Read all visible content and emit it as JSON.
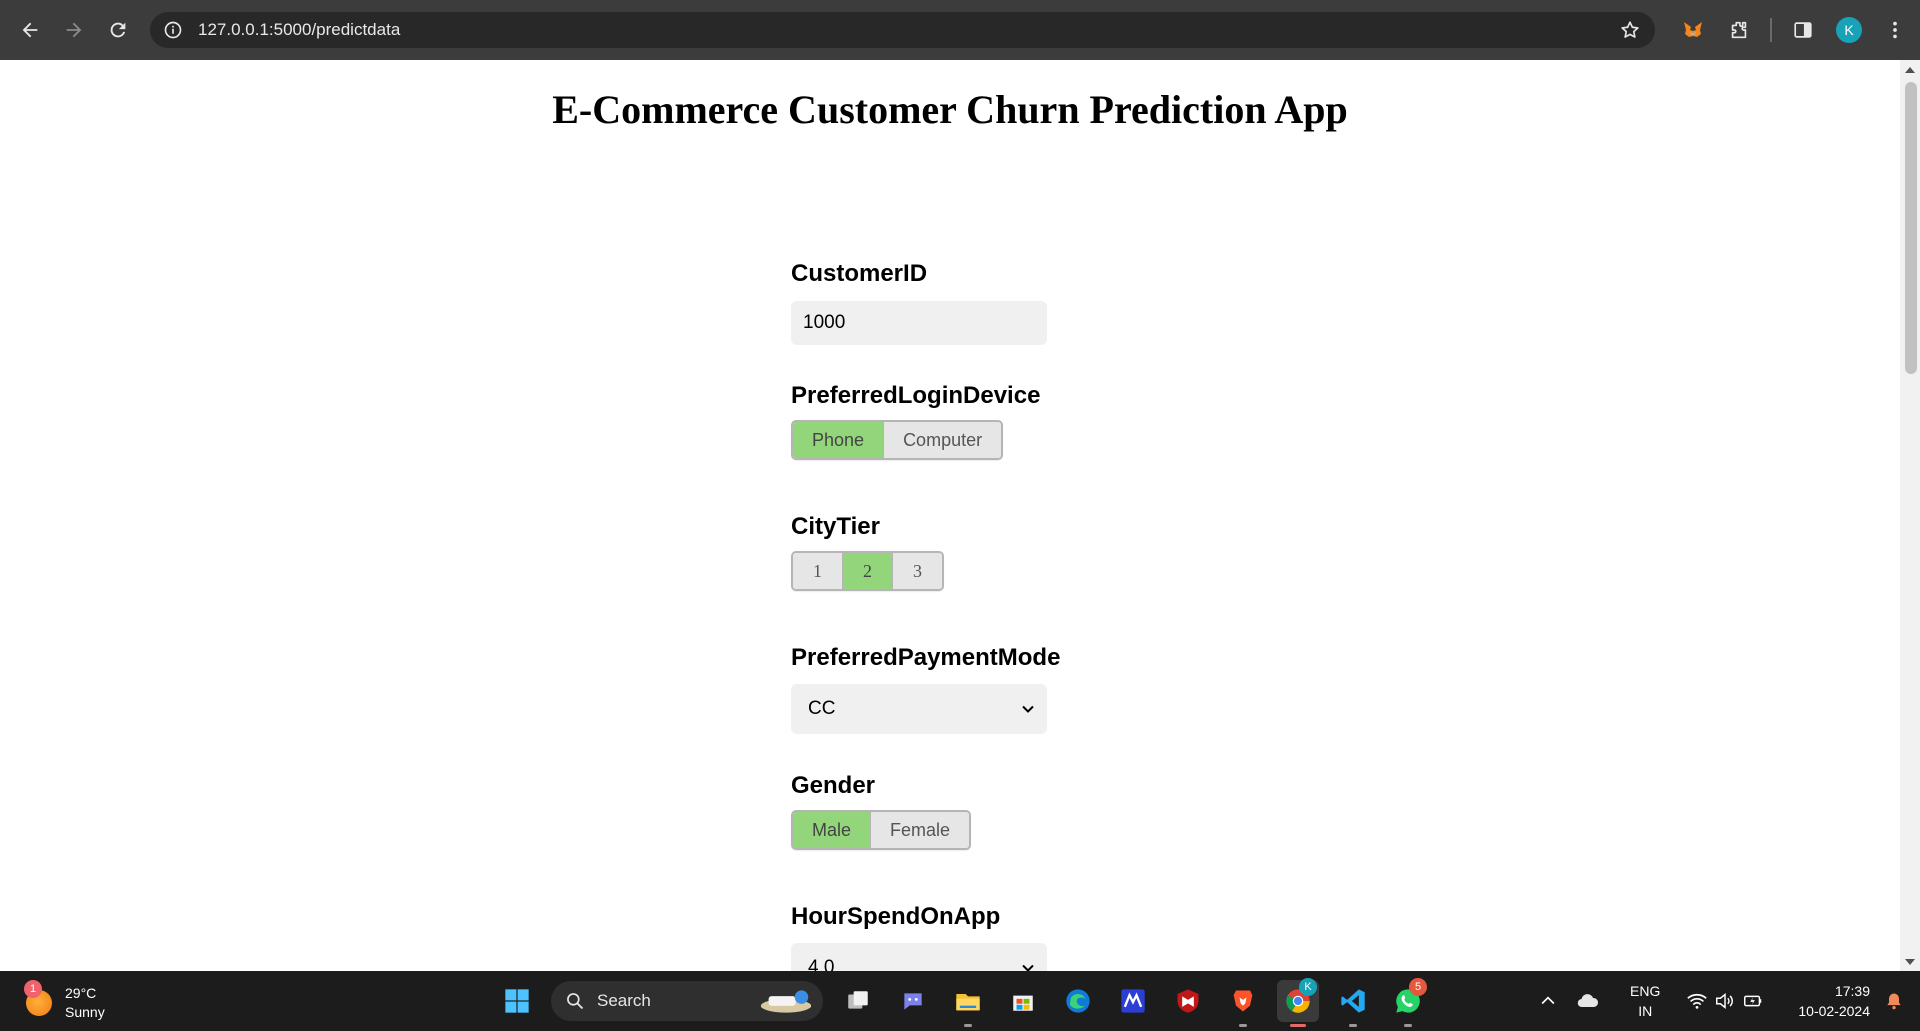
{
  "browser": {
    "url": "127.0.0.1:5000/predictdata",
    "profile_initial": "K"
  },
  "page": {
    "title": "E-Commerce Customer Churn Prediction App"
  },
  "form": {
    "customer_id": {
      "label": "CustomerID",
      "value": "1000"
    },
    "preferred_login_device": {
      "label": "PreferredLoginDevice",
      "options": [
        "Phone",
        "Computer"
      ],
      "selected": "Phone"
    },
    "city_tier": {
      "label": "CityTier",
      "options": [
        "1",
        "2",
        "3"
      ],
      "selected": "2"
    },
    "preferred_payment_mode": {
      "label": "PreferredPaymentMode",
      "value": "CC"
    },
    "gender": {
      "label": "Gender",
      "options": [
        "Male",
        "Female"
      ],
      "selected": "Male"
    },
    "hour_spend_on_app": {
      "label": "HourSpendOnApp",
      "value": "4.0"
    }
  },
  "colors": {
    "active_segment": "#93d57a",
    "chrome_bg": "#3c3c3c",
    "taskbar_bg": "#1c1c1c"
  },
  "taskbar": {
    "weather": {
      "temp": "29°C",
      "condition": "Sunny",
      "badge": "1"
    },
    "search_label": "Search",
    "whatsapp_badge": "5",
    "chrome_badge": "K",
    "language": {
      "line1": "ENG",
      "line2": "IN"
    },
    "clock": {
      "time": "17:39",
      "date": "10-02-2024"
    }
  }
}
